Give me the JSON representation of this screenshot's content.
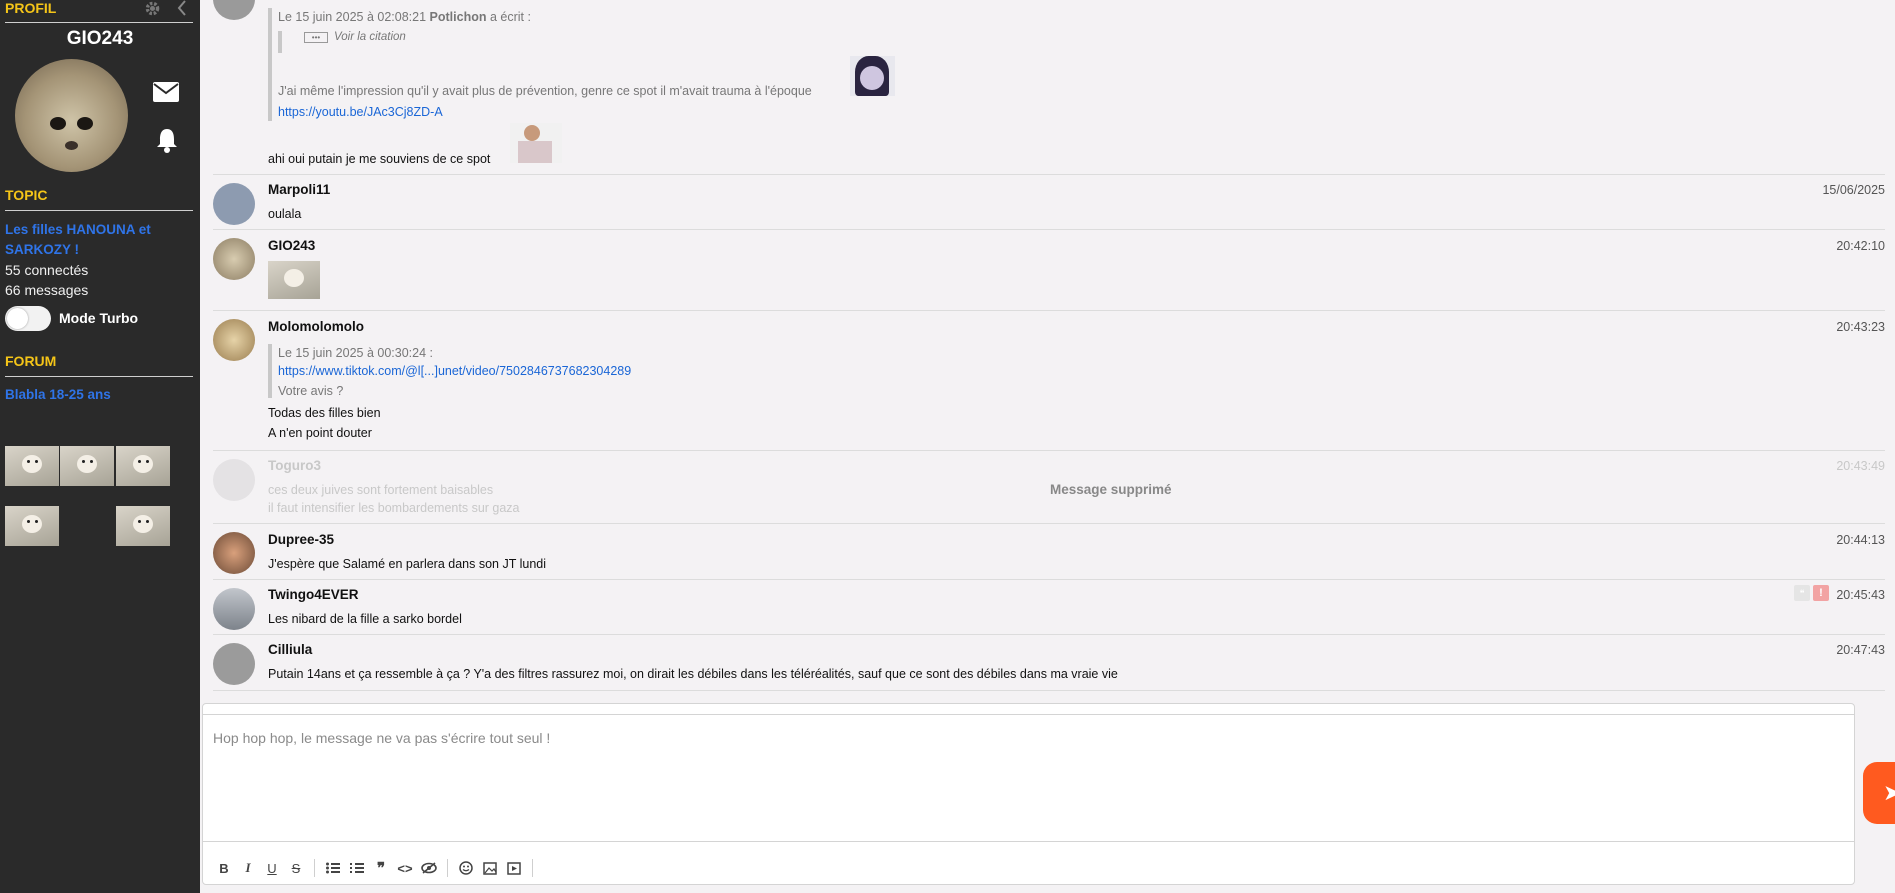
{
  "sidebar": {
    "profile_label": "PROFIL",
    "username": "GIO243",
    "topic_label": "TOPIC",
    "topic_title": "Les filles HANOUNA et SARKOZY !",
    "connected": "55 connectés",
    "messages_count": "66 messages",
    "turbo_label": "Mode Turbo",
    "forum_label": "FORUM",
    "forum_name": "Blabla 18-25 ans"
  },
  "messages": [
    {
      "quote_header_prefix": "Le 15 juin 2025 à 02:08:21 ",
      "quote_author": "Potlichon",
      "quote_header_suffix": " a écrit :",
      "quote_toggle": "Voir la citation",
      "quote_text": "J'ai même l'impression qu'il y avait plus de prévention, genre ce spot il m'avait trauma à l'époque",
      "quote_link": "https://youtu.be/JAc3Cj8ZD-A",
      "text": "ahi oui putain je me souviens de ce spot"
    },
    {
      "author": "Marpoli11",
      "time": "15/06/2025",
      "text": "oulala"
    },
    {
      "author": "GIO243",
      "time": "20:42:10"
    },
    {
      "author": "Molomolomolo",
      "time": "20:43:23",
      "quote_header": "Le 15 juin 2025 à 00:30:24 :",
      "quote_link": "https://www.tiktok.com/@l[...]unet/video/7502846737682304289",
      "quote_text": "Votre avis ?",
      "line1": "Todas des filles bien",
      "line2": "A n'en point douter"
    },
    {
      "author": "Toguro3",
      "time": "20:43:49",
      "line1": "ces deux juives sont fortement baisables",
      "line2": "il faut intensifier les bombardements sur gaza",
      "deleted_label": "Message supprimé"
    },
    {
      "author": "Dupree-35",
      "time": "20:44:13",
      "text": "J'espère que Salamé en parlera dans son JT lundi"
    },
    {
      "author": "Twingo4EVER",
      "time": "20:45:43",
      "text": "Les nibard de la fille a sarko bordel"
    },
    {
      "author": "Cilliula",
      "time": "20:47:43",
      "text": "Putain 14ans et ça ressemble à ça ? Y'a des filtres rassurez moi, on dirait les débiles dans les téléréalités, sauf que ce sont des débiles dans ma vraie vie"
    }
  ],
  "composer": {
    "placeholder": "Hop hop hop, le message ne va pas s'écrire tout seul !"
  },
  "toolbar_icons": [
    "bold-icon",
    "italic-icon",
    "underline-icon",
    "strikethrough-icon",
    "bullet-list-icon",
    "numbered-list-icon",
    "quote-icon",
    "code-icon",
    "spoiler-icon",
    "emoji-icon",
    "image-icon",
    "video-icon"
  ],
  "colors": {
    "accent": "#f5c518",
    "link": "#2f74e8",
    "send": "#ff5a1f"
  }
}
